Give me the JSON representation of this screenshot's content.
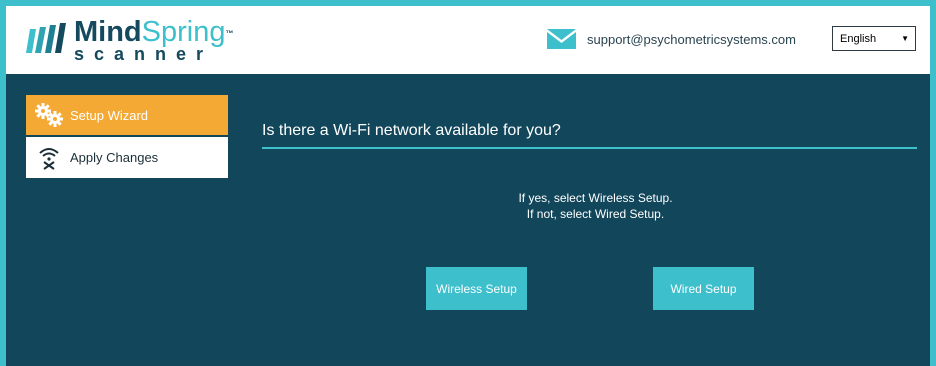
{
  "header": {
    "logo": {
      "word_1": "Mind",
      "word_2": "Spring",
      "trademark": "™",
      "subtitle": "scanner"
    },
    "support_email": "support@psychometricsystems.com",
    "language": {
      "selected": "English"
    }
  },
  "sidebar": {
    "items": [
      {
        "label": "Setup Wizard",
        "icon": "gears-icon",
        "active": true
      },
      {
        "label": "Apply Changes",
        "icon": "wifi-cancel-icon",
        "active": false
      }
    ]
  },
  "main": {
    "question": "Is there a Wi-Fi network available for you?",
    "instructions": [
      "If yes, select Wireless Setup.",
      "If not, select Wired Setup."
    ],
    "buttons": {
      "wireless": "Wireless Setup",
      "wired": "Wired Setup"
    }
  },
  "colors": {
    "background": "#12465a",
    "accent": "#3dbfcc",
    "active_item": "#f5a935",
    "header": "#ffffff"
  }
}
